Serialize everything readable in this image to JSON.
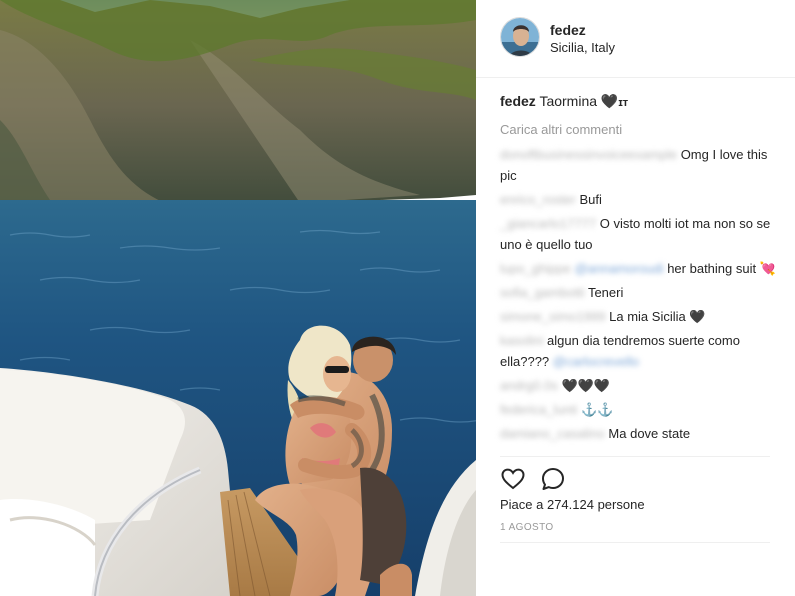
{
  "post": {
    "username": "fedez",
    "location": "Sicilia, Italy"
  },
  "caption": {
    "username": "fedez",
    "text": "Taormina 🖤",
    "badge": "ɪт"
  },
  "load_more_label": "Carica altri commenti",
  "comments": [
    {
      "user": "donoftbusinessinvoiceexample",
      "text": "Omg I love this pic"
    },
    {
      "user": "enrico_roster",
      "text": "Bufi"
    },
    {
      "user": "_giancarlo17777",
      "text": "O visto molti iot ma non so se uno è quello tuo"
    },
    {
      "user": "lupo_ghippe",
      "tag": "@annamoroudi",
      "text": "her bathing suit 💘"
    },
    {
      "user": "sofia_gambotti",
      "text": "Teneri"
    },
    {
      "user": "simone_simo1999",
      "text": "La mia Sicilia 🖤"
    },
    {
      "user": "kasolini",
      "text": "algun dia tendremos suerte como ella????",
      "tag_after": "@carlocrevello"
    },
    {
      "user": "andrg0.0s",
      "text": "🖤🖤🖤"
    },
    {
      "user": "federica_lunti",
      "text": "⚓⚓"
    },
    {
      "user": "damiano_casalino",
      "text": "Ma dove state"
    }
  ],
  "actions": {
    "like_icon": "heart-icon",
    "comment_icon": "comment-icon"
  },
  "likes_label": "Piace a 274.124 persone",
  "date_label": "1 AGOSTO",
  "colors": {
    "text": "#262626",
    "muted": "#999999",
    "border": "#efefef",
    "sea": "#1d4d7a"
  }
}
